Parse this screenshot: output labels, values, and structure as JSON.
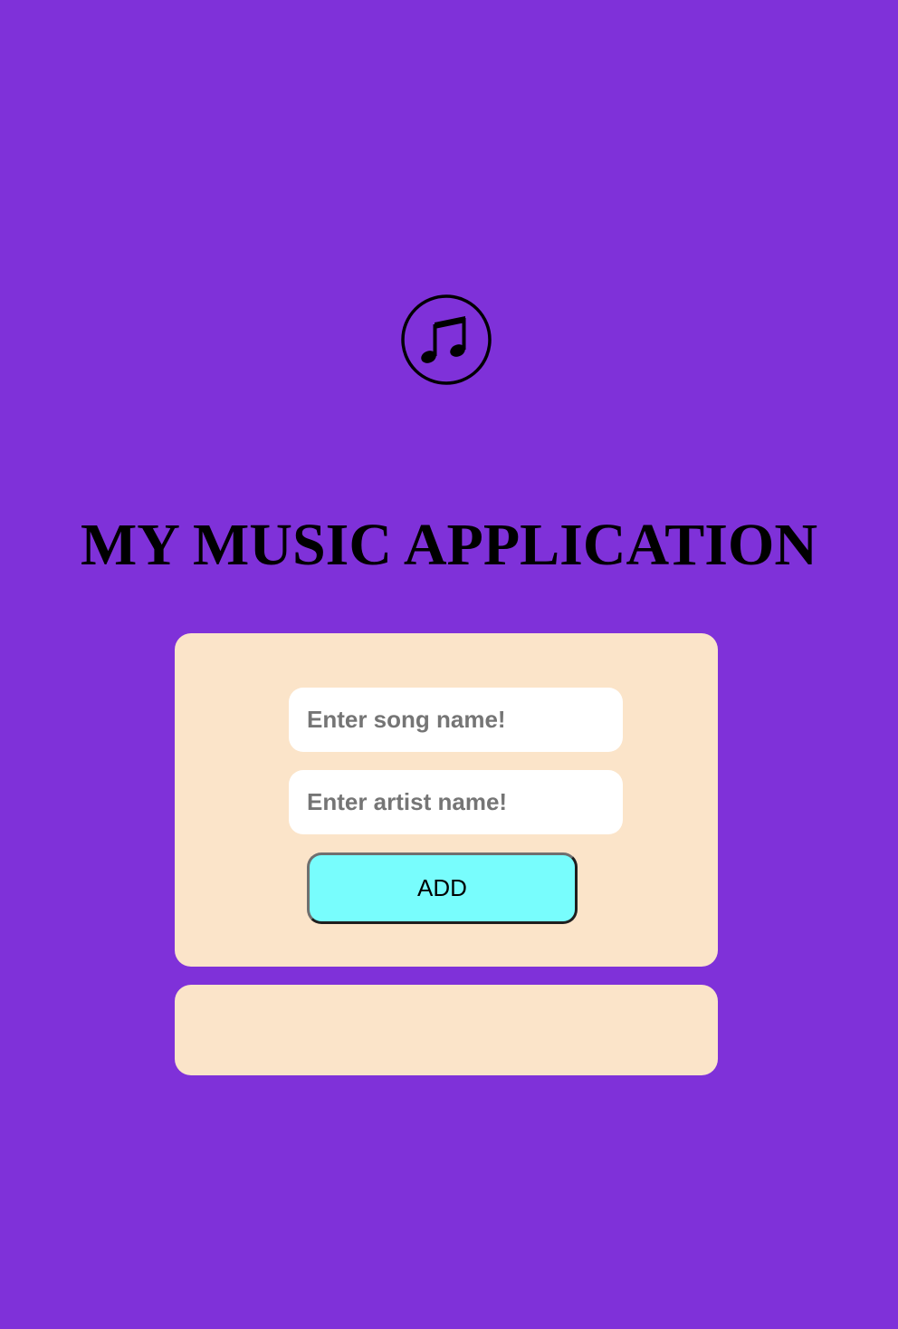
{
  "app": {
    "title": "MY MUSIC APPLICATION",
    "logo_icon": "music-note-icon"
  },
  "form": {
    "song_placeholder": "Enter song name!",
    "song_value": "",
    "artist_placeholder": "Enter artist name!",
    "artist_value": "",
    "add_label": "ADD"
  },
  "songs": [],
  "colors": {
    "background": "#7f31d9",
    "card": "#fbe4c9",
    "input": "#ffffff",
    "button": "#78fdfd",
    "text": "#000000"
  }
}
